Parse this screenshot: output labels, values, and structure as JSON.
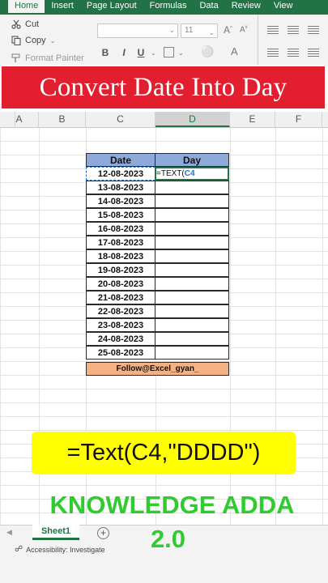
{
  "ribbon": {
    "tabs": [
      "Home",
      "Insert",
      "Page Layout",
      "Formulas",
      "Data",
      "Review",
      "View"
    ],
    "active_tab": "Home",
    "clipboard": {
      "cut_label": "Cut",
      "copy_label": "Copy",
      "format_painter_label": "Format Painter"
    },
    "font_size": "11",
    "format_buttons": [
      "B",
      "I",
      "U"
    ],
    "font_grow": "A",
    "font_shrink": "A",
    "font_color": "A"
  },
  "banner": {
    "title": "Convert Date Into Day",
    "color": "#e31e2f"
  },
  "sheet": {
    "columns": [
      "A",
      "B",
      "C",
      "D",
      "E",
      "F"
    ],
    "selected_column": "D",
    "table": {
      "headers": [
        "Date",
        "Day"
      ],
      "dates": [
        "12-08-2023",
        "13-08-2023",
        "14-08-2023",
        "15-08-2023",
        "16-08-2023",
        "17-08-2023",
        "18-08-2023",
        "19-08-2023",
        "20-08-2023",
        "21-08-2023",
        "22-08-2023",
        "23-08-2023",
        "24-08-2023",
        "25-08-2023"
      ],
      "editing_formula_prefix": "=TEXT(",
      "editing_formula_ref": "C4",
      "footer": "Follow@Excel_gyan_",
      "header_color": "#8eaadb",
      "footer_color": "#f4b183"
    }
  },
  "callout": {
    "formula": "=Text(C4,\"DDDD\")",
    "color": "#ffff00"
  },
  "brand": {
    "line1": "KNOWLEDGE ADDA",
    "line2": "2.0",
    "color": "#2ecc2e"
  },
  "sheet_tabs": {
    "active": "Sheet1",
    "add_label": "+"
  },
  "status": {
    "accessibility": "Accessibility: Investigate"
  },
  "accent": "#217346"
}
